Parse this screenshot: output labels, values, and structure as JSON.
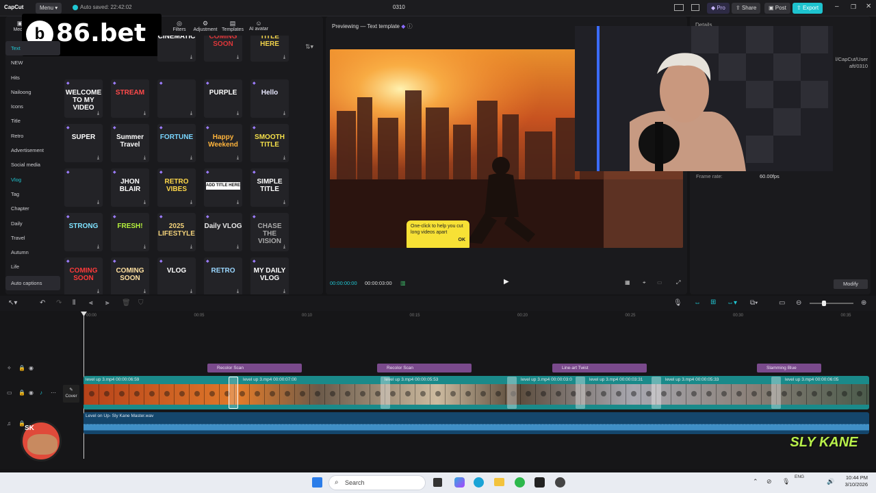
{
  "app": {
    "name": "CapCut",
    "menu_label": "Menu",
    "autosave": "Auto saved: 22:42:02",
    "project_title": "0310",
    "pro_label": "Pro",
    "share_label": "Share",
    "post_label": "Post",
    "export_label": "Export"
  },
  "watermark": {
    "brand": "86.bet"
  },
  "top_tabs": [
    {
      "label": "Media"
    },
    {
      "label": "Filters"
    },
    {
      "label": "Adjustment"
    },
    {
      "label": "Templates"
    },
    {
      "label": "AI avatar"
    }
  ],
  "categories": [
    {
      "label": "Text"
    },
    {
      "label": "NEW"
    },
    {
      "label": "Hits"
    },
    {
      "label": "Nailoong"
    },
    {
      "label": "Icons"
    },
    {
      "label": "Title"
    },
    {
      "label": "Retro"
    },
    {
      "label": "Advertisement"
    },
    {
      "label": "Social media"
    },
    {
      "label": "Vlog"
    },
    {
      "label": "Tag"
    },
    {
      "label": "Chapter"
    },
    {
      "label": "Daily"
    },
    {
      "label": "Travel"
    },
    {
      "label": "Autumn"
    },
    {
      "label": "Life"
    },
    {
      "label": "Auto captions"
    }
  ],
  "tiles": [
    {
      "text": "CINEMATIC",
      "color": "#ffffff"
    },
    {
      "text": "COMING SOON",
      "color": "#e0373a"
    },
    {
      "text": "TITLE HERE",
      "color": "#f2d44a"
    },
    {
      "text": "WELCOME TO MY VIDEO",
      "color": "#ffffff"
    },
    {
      "text": "STREAM",
      "color": "#ff4a4a"
    },
    {
      "text": "",
      "color": "#ffffff"
    },
    {
      "text": "PURPLE",
      "color": "#ffffff"
    },
    {
      "text": "Hello",
      "color": "#e8e8ff"
    },
    {
      "text": "SUPER",
      "color": "#ffffff"
    },
    {
      "text": "Summer Travel",
      "color": "#ffffff"
    },
    {
      "text": "FORTUNE",
      "color": "#79d6ff"
    },
    {
      "text": "Happy Weekend",
      "color": "#ffb43c"
    },
    {
      "text": "SMOOTH TITLE",
      "color": "#f5e04a"
    },
    {
      "text": "",
      "color": "#ffffff"
    },
    {
      "text": "JHON BLAIR",
      "color": "#ffffff"
    },
    {
      "text": "RETRO VIBES",
      "color": "#ffd84a"
    },
    {
      "text": "ADD TITLE HERE",
      "color": "#111111"
    },
    {
      "text": "SIMPLE TITLE",
      "color": "#ffffff"
    },
    {
      "text": "STRONG",
      "color": "#7fe3ff"
    },
    {
      "text": "FRESH!",
      "color": "#b6f23c"
    },
    {
      "text": "2025 LIFESTYLE",
      "color": "#f3d27a"
    },
    {
      "text": "Daily VLOG",
      "color": "#e8e8e8"
    },
    {
      "text": "CHASE THE VISION",
      "color": "#aaaaaa"
    },
    {
      "text": "COMING SOON",
      "color": "#ff3a3a"
    },
    {
      "text": "COMING SOON",
      "color": "#ffe0a0"
    },
    {
      "text": "VLOG",
      "color": "#ffffff"
    },
    {
      "text": "RETRO",
      "color": "#9ad7ff"
    },
    {
      "text": "MY DAILY VLOG",
      "color": "#ffffff"
    }
  ],
  "preview": {
    "header": "Previewing — Text template",
    "tooltip": "One-click to help you cut long videos apart",
    "tooltip_ok": "OK",
    "time_current": "00:00:00:00",
    "time_total": "00:00:03:00"
  },
  "details": {
    "title": "Details",
    "path_line1": "l/CapCut/User",
    "path_line2": "aft/0310",
    "frame_rate_label": "Frame rate:",
    "frame_rate_value": "60.00fps",
    "modify_label": "Modify"
  },
  "ruler": [
    "00:00",
    "00:05",
    "00:10",
    "00:15",
    "00:20",
    "00:25",
    "00:30",
    "00:35"
  ],
  "effects": [
    {
      "label": "Recolor Scan"
    },
    {
      "label": "Recolor Scan"
    },
    {
      "label": "Line-art Twist"
    },
    {
      "label": "Slamming Blue"
    }
  ],
  "video_clips": [
    {
      "label": "level up 3.mp4  00:00:06:59"
    },
    {
      "label": "level up 3.mp4  00:00:07:00"
    },
    {
      "label": "level up 3.mp4  00:00:05:53"
    },
    {
      "label": "level up 3.mp4  00:00:03:0"
    },
    {
      "label": "level up 3.mp4  00:00:03:31"
    },
    {
      "label": "level up 3.mp4  00:00:05:33"
    },
    {
      "label": "level up 3.mp4  00:00:06:05"
    }
  ],
  "cover_label": "Cover",
  "audio_label": "Level on Up- Sly Kane Master.wav",
  "streamer_logo": {
    "left": "SK",
    "right": "SLY KANE"
  },
  "taskbar": {
    "search": "Search",
    "time": "10:44 PM",
    "date": "3/10/2026",
    "lang": "ENG"
  },
  "colors": {
    "accent": "#20c7d3",
    "export": "#1ec3cf",
    "pro": "#8b6cff"
  }
}
